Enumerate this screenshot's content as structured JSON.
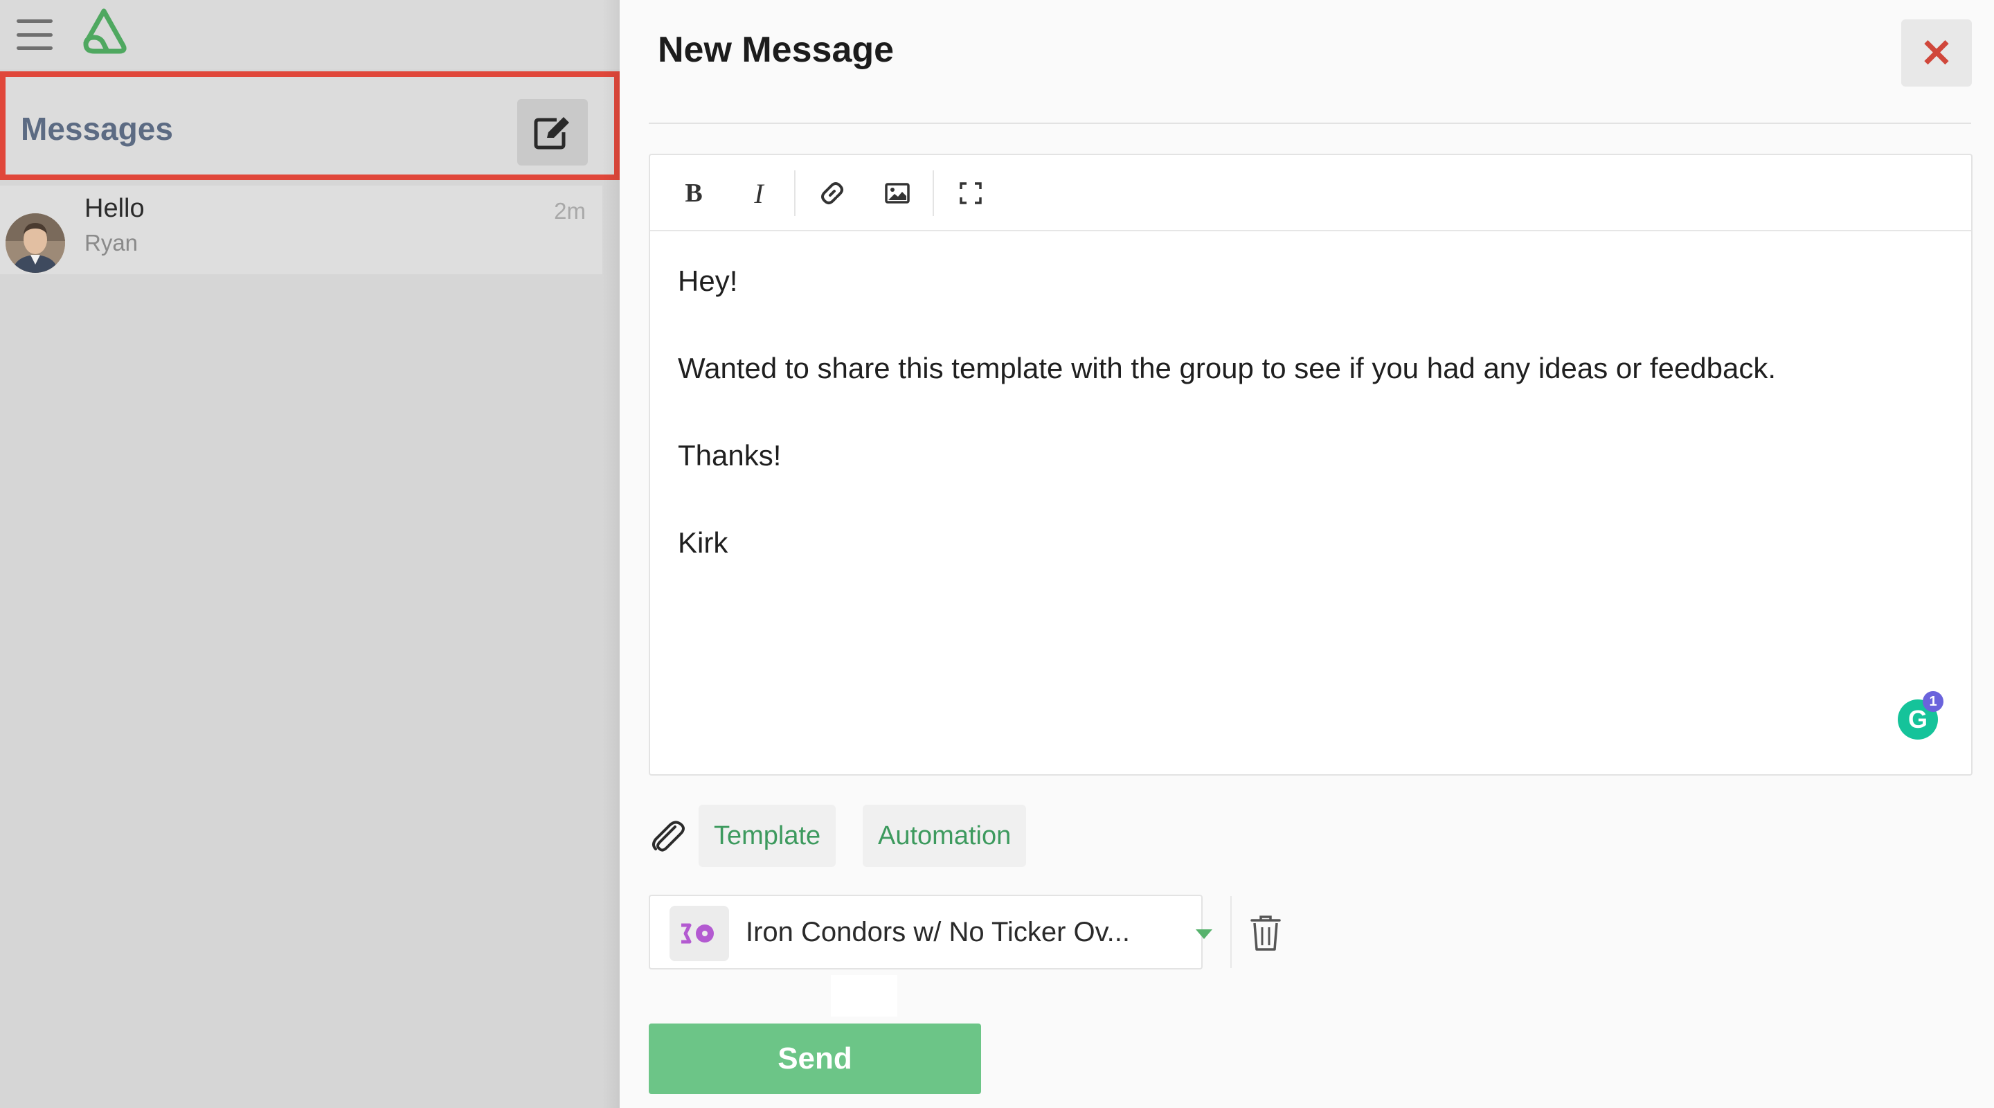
{
  "app": {
    "menu_icon": "hamburger-menu-icon",
    "logo_icon": "triangle-loop-logo",
    "brand_color": "#3d9a5e"
  },
  "sidebar": {
    "title": "Messages",
    "compose_icon": "compose-edit-icon",
    "highlight_color": "#e0473a",
    "conversations": [
      {
        "subject": "Hello",
        "from": "Ryan",
        "time": "2m"
      }
    ]
  },
  "composer": {
    "title": "New Message",
    "close_icon": "close-x-icon",
    "toolbar": {
      "bold_label": "B",
      "italic_label": "I",
      "link_icon": "link-icon",
      "image_icon": "image-icon",
      "fullscreen_icon": "fullscreen-icon"
    },
    "body": {
      "greeting": "Hey!",
      "paragraph": "Wanted to share this template with the group to see if you had any ideas or feedback.",
      "closing": "Thanks!",
      "signature": "Kirk"
    },
    "grammarly": {
      "letter": "G",
      "badge_count": "1"
    },
    "attach_icon": "paperclip-icon",
    "template_button": "Template",
    "automation_button": "Automation",
    "attached_template": {
      "name": "Iron Condors w/ No Ticker Ov...",
      "icon": "template-type-icon",
      "dropdown_icon": "caret-down-icon",
      "delete_icon": "trash-icon"
    },
    "send_button": "Send"
  }
}
